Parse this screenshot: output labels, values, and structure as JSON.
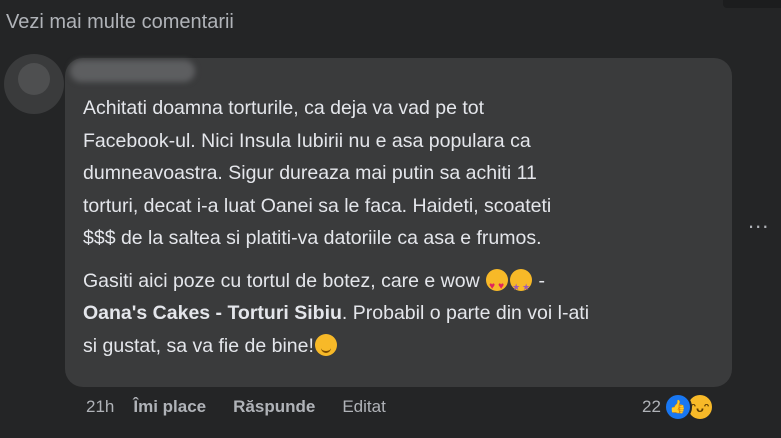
{
  "header": {
    "more_comments": "Vezi mai multe comentarii"
  },
  "comment": {
    "paragraph1": [
      "Achitati doamna torturile, ca deja va vad pe tot",
      "Facebook-ul. Nici Insula Iubirii nu e asa populara ca",
      "dumneavoastra. Sigur dureaza mai putin sa achiti 11",
      "torturi, decat i-a luat Oanei sa le faca. Haideti, scoateti",
      "$$$ de la saltea si platiti-va datoriile ca asa e frumos."
    ],
    "paragraph2_line1_text": "Gasiti aici poze cu tortul de botez, care e wow",
    "paragraph2_line1_dash": " -",
    "paragraph2_line2_bold": "Oana's Cakes - Torturi Sibiu",
    "paragraph2_line2_rest": ". Probabil o parte din voi l-ati",
    "paragraph2_line3": "si gustat, sa va fie de bine!",
    "emojis": [
      "smiling-face-with-hearts",
      "star-struck",
      "relieved-face"
    ]
  },
  "actions": {
    "time": "21h",
    "like": "Îmi place",
    "reply": "Răspunde",
    "edited": "Editat"
  },
  "reactions": {
    "count": "22",
    "icons": [
      "like-icon",
      "haha-icon"
    ],
    "like_color": "#1877f2",
    "haha_color": "#f7b928"
  },
  "more_options_glyph": "..."
}
